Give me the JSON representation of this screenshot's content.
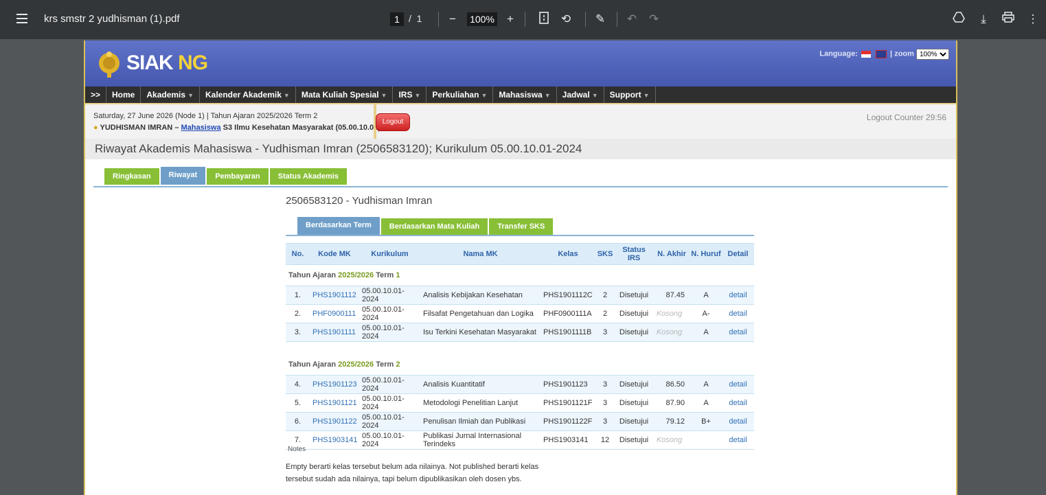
{
  "viewer": {
    "filename": "krs smstr 2 yudhisman (1).pdf",
    "page_current": "1",
    "page_total": "1",
    "zoom": "100%",
    "page_sep": "/"
  },
  "site": {
    "logo_siak": "SIAK",
    "logo_ng": "NG",
    "language_label": "Language:",
    "zoom_label": "zoom",
    "zoom_value": "100%"
  },
  "nav": {
    "toggle": ">>",
    "items": [
      {
        "label": "Home",
        "caret": false
      },
      {
        "label": "Akademis",
        "caret": true
      },
      {
        "label": "Kalender Akademik",
        "caret": true
      },
      {
        "label": "Mata Kuliah Spesial",
        "caret": true
      },
      {
        "label": "IRS",
        "caret": true
      },
      {
        "label": "Perkuliahan",
        "caret": true
      },
      {
        "label": "Mahasiswa",
        "caret": true
      },
      {
        "label": "Jadwal",
        "caret": true
      },
      {
        "label": "Support",
        "caret": true
      }
    ]
  },
  "info": {
    "date_line": "Saturday, 27 June 2026 (Node 1) | Tahun Ajaran 2025/2026 Term 2",
    "user_name": "YUDHISMAN IMRAN –",
    "user_role": "Mahasiswa",
    "user_program": "S3 Ilmu Kesehatan Masyarakat (05.00.10.01)",
    "logout": "Logout",
    "logout_counter": "Logout Counter 29:56"
  },
  "page_title": "Riwayat Akademis Mahasiswa - Yudhisman Imran (2506583120); Kurikulum 05.00.10.01-2024",
  "tabs_main": [
    {
      "label": "Ringkasan",
      "active": false
    },
    {
      "label": "Riwayat",
      "active": true
    },
    {
      "label": "Pembayaran",
      "active": false
    },
    {
      "label": "Status Akademis",
      "active": false
    }
  ],
  "student_heading": "2506583120 - Yudhisman Imran",
  "tabs_sub": [
    {
      "label": "Berdasarkan Term",
      "active": true
    },
    {
      "label": "Berdasarkan Mata Kuliah",
      "active": false
    },
    {
      "label": "Transfer SKS",
      "active": false
    }
  ],
  "table": {
    "headers": [
      "No.",
      "Kode MK",
      "Kurikulum",
      "Nama MK",
      "Kelas",
      "SKS",
      "Status IRS",
      "N. Akhir",
      "N. Huruf",
      "Detail"
    ],
    "terms": [
      {
        "prefix": "Tahun Ajaran",
        "year": "2025/2026",
        "term_label": "Term",
        "term_num": "1",
        "rows": [
          {
            "no": "1.",
            "kode": "PHS1901112",
            "kurikulum": "05.00.10.01-2024",
            "nama": "Analisis Kebijakan Kesehatan",
            "kelas": "PHS1901112C",
            "sks": "2",
            "status": "Disetujui",
            "akhir": "87.45",
            "akhir_empty": false,
            "huruf": "A",
            "detail": "detail"
          },
          {
            "no": "2.",
            "kode": "PHF0900111",
            "kurikulum": "05.00.10.01-2024",
            "nama": "Filsafat Pengetahuan dan Logika",
            "kelas": "PHF0900111A",
            "sks": "2",
            "status": "Disetujui",
            "akhir": "Kosong",
            "akhir_empty": true,
            "huruf": "A-",
            "detail": "detail"
          },
          {
            "no": "3.",
            "kode": "PHS1901111",
            "kurikulum": "05.00.10.01-2024",
            "nama": "Isu Terkini Kesehatan Masyarakat",
            "kelas": "PHS1901111B",
            "sks": "3",
            "status": "Disetujui",
            "akhir": "Kosong",
            "akhir_empty": true,
            "huruf": "A",
            "detail": "detail"
          }
        ]
      },
      {
        "prefix": "Tahun Ajaran",
        "year": "2025/2026",
        "term_label": "Term",
        "term_num": "2",
        "rows": [
          {
            "no": "4.",
            "kode": "PHS1901123",
            "kurikulum": "05.00.10.01-2024",
            "nama": "Analisis Kuantitatif",
            "kelas": "PHS1901123",
            "sks": "3",
            "status": "Disetujui",
            "akhir": "86.50",
            "akhir_empty": false,
            "huruf": "A",
            "detail": "detail"
          },
          {
            "no": "5.",
            "kode": "PHS1901121",
            "kurikulum": "05.00.10.01-2024",
            "nama": "Metodologi Penelitian Lanjut",
            "kelas": "PHS1901121F",
            "sks": "3",
            "status": "Disetujui",
            "akhir": "87.90",
            "akhir_empty": false,
            "huruf": "A",
            "detail": "detail"
          },
          {
            "no": "6.",
            "kode": "PHS1901122",
            "kurikulum": "05.00.10.01-2024",
            "nama": "Penulisan Ilmiah dan Publikasi",
            "kelas": "PHS1901122F",
            "sks": "3",
            "status": "Disetujui",
            "akhir": "79.12",
            "akhir_empty": false,
            "huruf": "B+",
            "detail": "detail"
          },
          {
            "no": "7.",
            "kode": "PHS1903141",
            "kurikulum": "05.00.10.01-2024",
            "nama": "Publikasi Jurnal Internasional Terindeks",
            "kelas": "PHS1903141",
            "sks": "12",
            "status": "Disetujui",
            "akhir": "Kosong",
            "akhir_empty": true,
            "huruf": "",
            "detail": "detail"
          }
        ]
      }
    ]
  },
  "notes": {
    "label": "Notes",
    "text": "Empty berarti kelas tersebut belum ada nilainya. Not published berarti kelas tersebut sudah ada nilainya, tapi belum dipublikasikan oleh dosen ybs."
  },
  "colors": {
    "header_blue": "#4557ae",
    "tab_green": "#88bf36",
    "tab_active_blue": "#6f9fc9",
    "link_blue": "#2f6fb5"
  }
}
